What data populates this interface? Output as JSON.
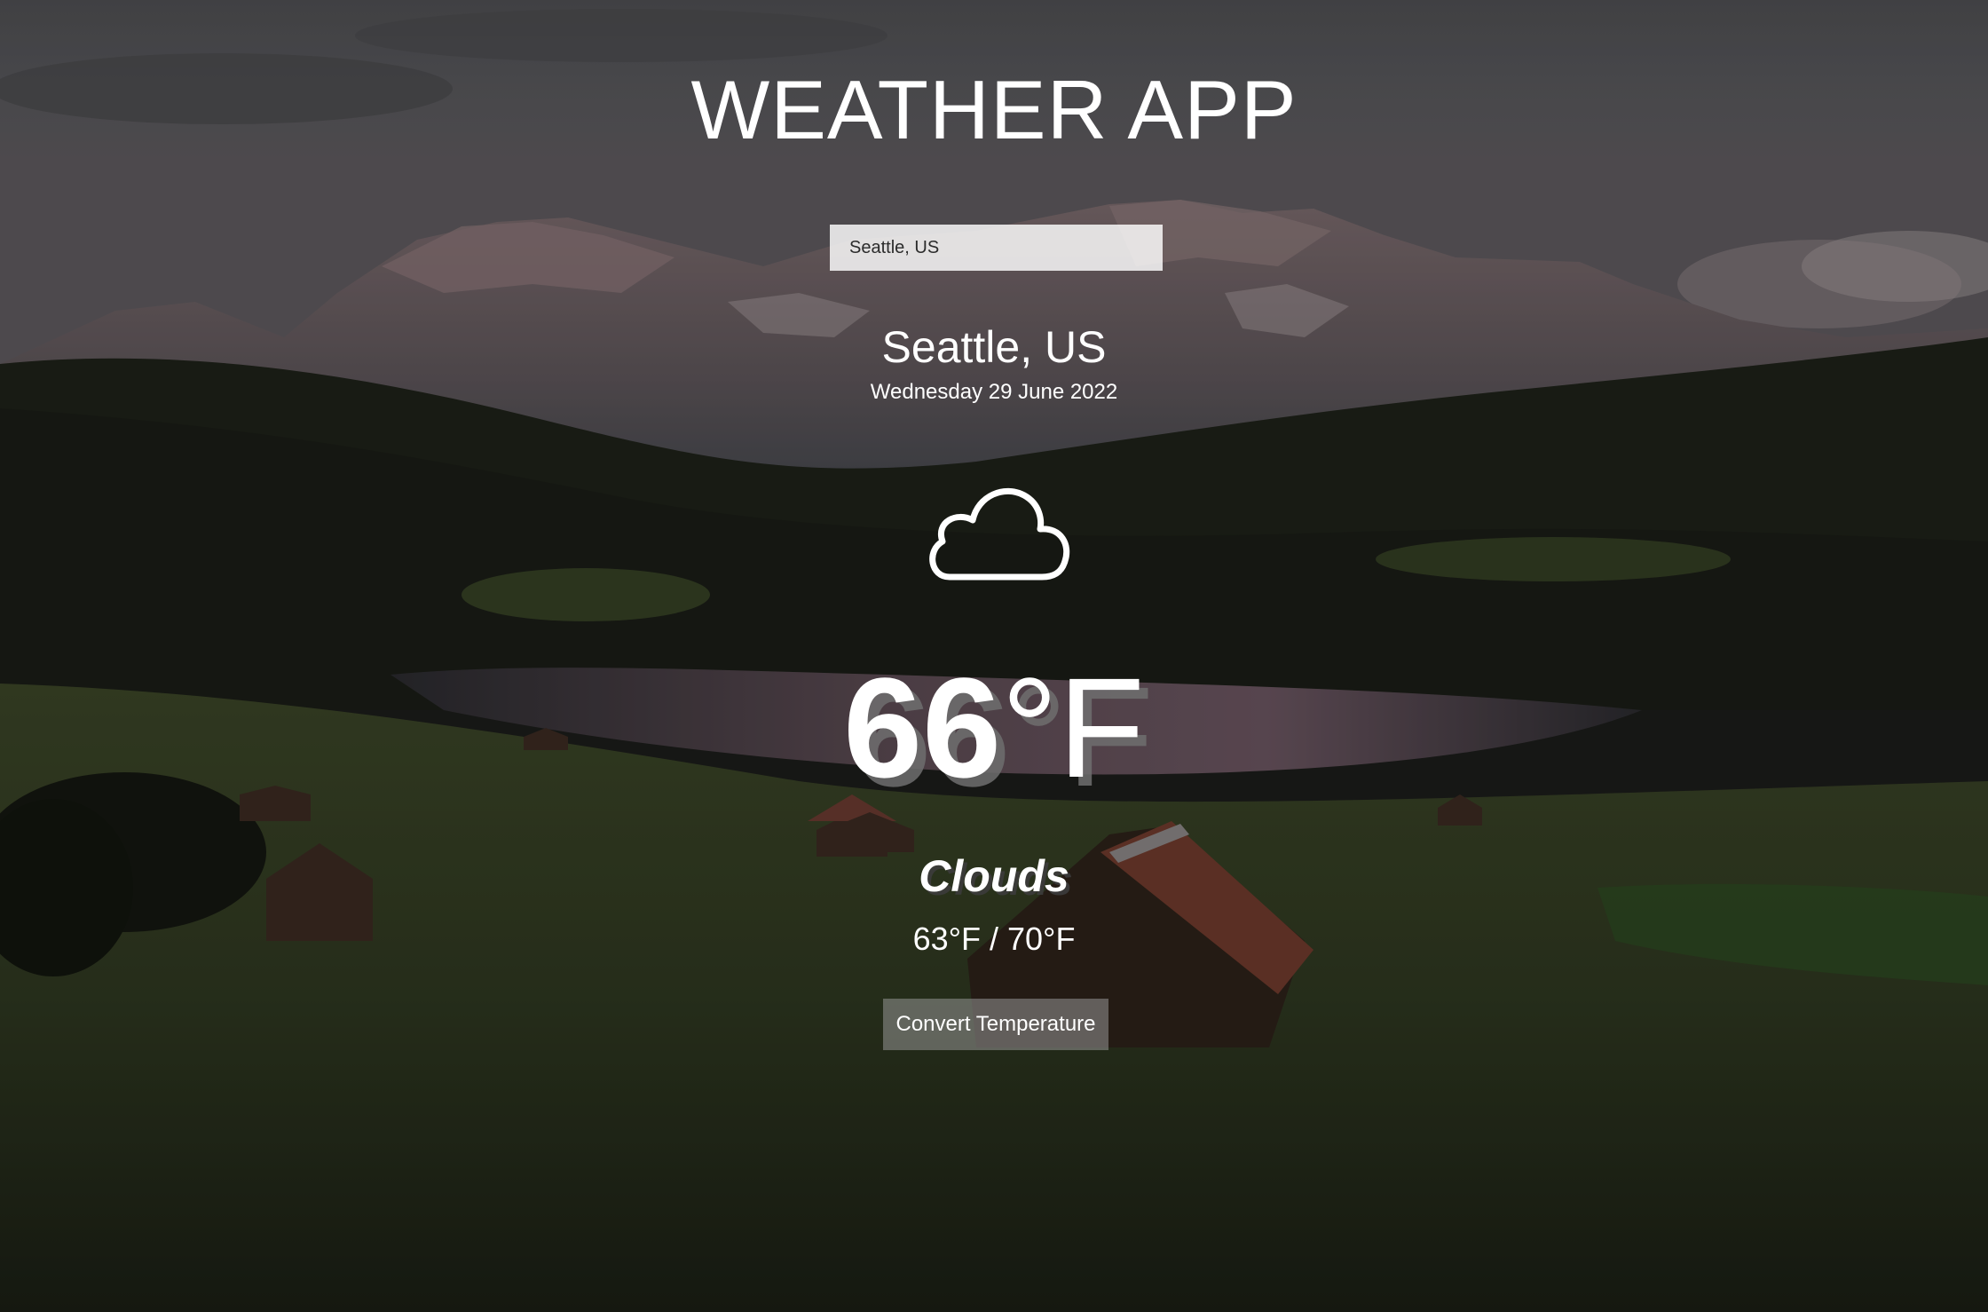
{
  "app": {
    "title": "WEATHER APP"
  },
  "search": {
    "value": "Seattle, US",
    "placeholder": ""
  },
  "location": {
    "city": "Seattle, US",
    "date": "Wednesday 29 June 2022"
  },
  "weather": {
    "icon": "cloud-icon",
    "temperature": "66",
    "unit": "°F",
    "condition": "Clouds",
    "range": "63°F / 70°F"
  },
  "actions": {
    "convert_label": "Convert Temperature"
  },
  "colors": {
    "text": "#ffffff",
    "button_bg": "#969696",
    "input_bg": "#ffffff"
  },
  "background": {
    "description_icon": "mountain-lake-landscape"
  }
}
